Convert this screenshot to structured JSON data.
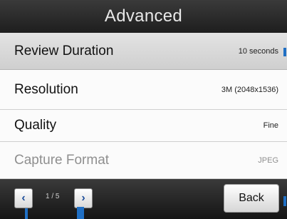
{
  "header": {
    "title": "Advanced"
  },
  "settings": [
    {
      "label": "Review Duration",
      "value": "10 seconds"
    },
    {
      "label": "Resolution",
      "value": "3M (2048x1536)"
    },
    {
      "label": "Quality",
      "value": "Fine"
    },
    {
      "label": "Capture Format",
      "value": "JPEG"
    }
  ],
  "footer": {
    "prev_icon": "‹",
    "next_icon": "›",
    "page": "1 / 5",
    "back_label": "Back"
  },
  "colors": {
    "accent_marker": "#1f6fc4",
    "selected_row": "#d8d8d8"
  }
}
